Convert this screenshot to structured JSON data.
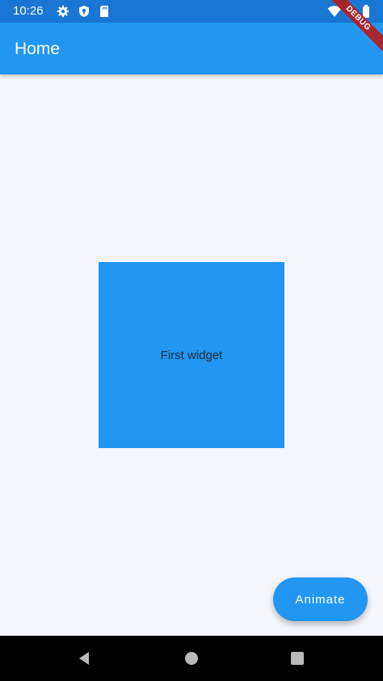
{
  "status_bar": {
    "time": "10:26",
    "icons": [
      "gear-icon",
      "shield-icon",
      "sd-card-icon",
      "wifi-icon",
      "battery-icon"
    ]
  },
  "debug_banner": {
    "label": "DEBUG"
  },
  "app_bar": {
    "title": "Home",
    "color": "#2196f3"
  },
  "main": {
    "widget_label": "First widget",
    "widget_color": "#2196f3"
  },
  "fab": {
    "label": "Animate"
  },
  "nav_bar": {
    "buttons": [
      "back-icon",
      "home-icon",
      "recents-icon"
    ]
  },
  "colors": {
    "status_bar": "#1976d2",
    "background": "#f5f6fb",
    "nav_bar": "#000000"
  }
}
